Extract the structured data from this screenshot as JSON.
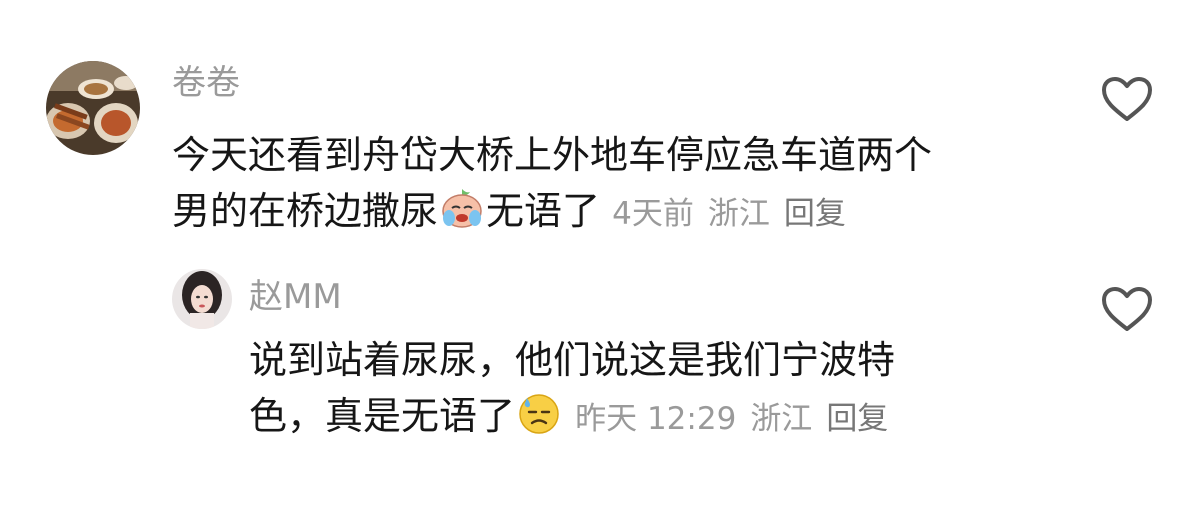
{
  "comments": [
    {
      "username": "卷卷",
      "line1": "今天还看到舟岱大桥上外地车停应急车道两个",
      "line2_before": "男的在桥边撒尿",
      "emoji_icon": "crying-face-icon",
      "line2_after": "无语了",
      "time": "4天前",
      "location": "浙江",
      "reply_label": "回复",
      "avatar_icon": "food-photo-avatar"
    },
    {
      "username": "赵MM",
      "line1": "说到站着尿尿，他们说这是我们宁波特",
      "line2_before": "色，真是无语了",
      "emoji_icon": "sweat-face-icon",
      "time": "昨天 12:29",
      "location": "浙江",
      "reply_label": "回复",
      "avatar_icon": "portrait-photo-avatar"
    }
  ],
  "colors": {
    "text": "#161616",
    "muted": "#9a9a9a",
    "icon_stroke": "#555555"
  }
}
